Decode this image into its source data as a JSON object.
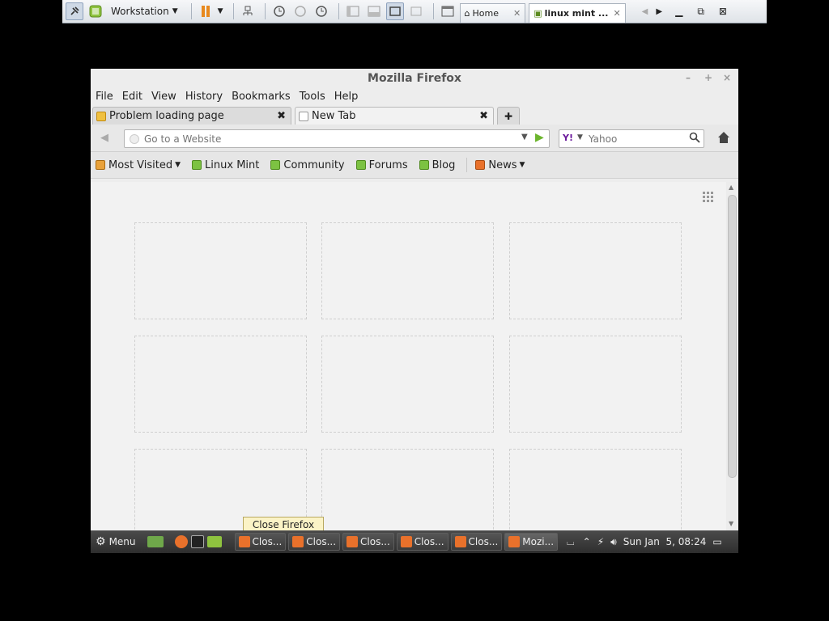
{
  "vmware": {
    "title": "Workstation",
    "tabs": [
      {
        "label": "Home"
      },
      {
        "label": "linux mint ..."
      }
    ]
  },
  "firefox": {
    "window_title": "Mozilla Firefox",
    "window_controls": [
      "–",
      "+",
      "×"
    ],
    "menu": [
      "File",
      "Edit",
      "View",
      "History",
      "Bookmarks",
      "Tools",
      "Help"
    ],
    "tabs": [
      {
        "label": "Problem loading page",
        "active": false
      },
      {
        "label": "New Tab",
        "active": true
      }
    ],
    "new_tab_symbol": "✚",
    "address": {
      "placeholder": "Go to a Website",
      "value": ""
    },
    "search": {
      "engine_label": "Y!",
      "placeholder": "Yahoo"
    },
    "bookmarks": [
      {
        "label": "Most Visited",
        "dropdown": true,
        "icon": "folder-icon"
      },
      {
        "label": "Linux Mint",
        "icon": "mint-icon"
      },
      {
        "label": "Community",
        "icon": "mint-icon"
      },
      {
        "label": "Forums",
        "icon": "mint-icon"
      },
      {
        "label": "Blog",
        "icon": "mint-icon"
      },
      {
        "label": "News",
        "dropdown": true,
        "icon": "rss-icon"
      }
    ],
    "tiles_count_label": "",
    "tooltip": "Close Firefox"
  },
  "taskbar": {
    "menu_label": "Menu",
    "windows": [
      {
        "label": "Clos..."
      },
      {
        "label": "Clos..."
      },
      {
        "label": "Clos..."
      },
      {
        "label": "Clos..."
      },
      {
        "label": "Clos..."
      },
      {
        "label": "Mozi..."
      }
    ],
    "clock": "Sun Jan  5, 08:24"
  },
  "colors": {
    "accent_green": "#6cb52d",
    "mint_green": "#7cc242",
    "firefox_orange": "#e9712b"
  }
}
